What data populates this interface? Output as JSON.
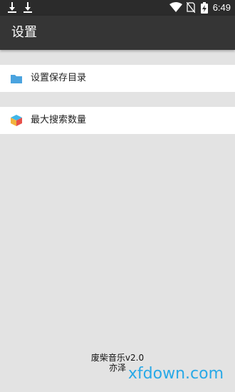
{
  "status_bar": {
    "time": "6:49",
    "icons": [
      "download-icon",
      "download-icon",
      "wifi-icon",
      "no-sim-icon",
      "battery-charging-icon"
    ]
  },
  "app_bar": {
    "title": "设置"
  },
  "settings": [
    {
      "label": "设置保存目录",
      "icon": "folder-icon"
    },
    {
      "label": "最大搜索数量",
      "icon": "cube-icon"
    }
  ],
  "footer": {
    "app_name": "废柴音乐v2.0",
    "author": "亦泽"
  },
  "watermark": "xfdown.com",
  "colors": {
    "status_bar": "#2b2b2b",
    "app_bar": "#353535",
    "background": "#e3e3e3",
    "folder": "#4aa3df",
    "watermark": "#1ea6e8"
  }
}
